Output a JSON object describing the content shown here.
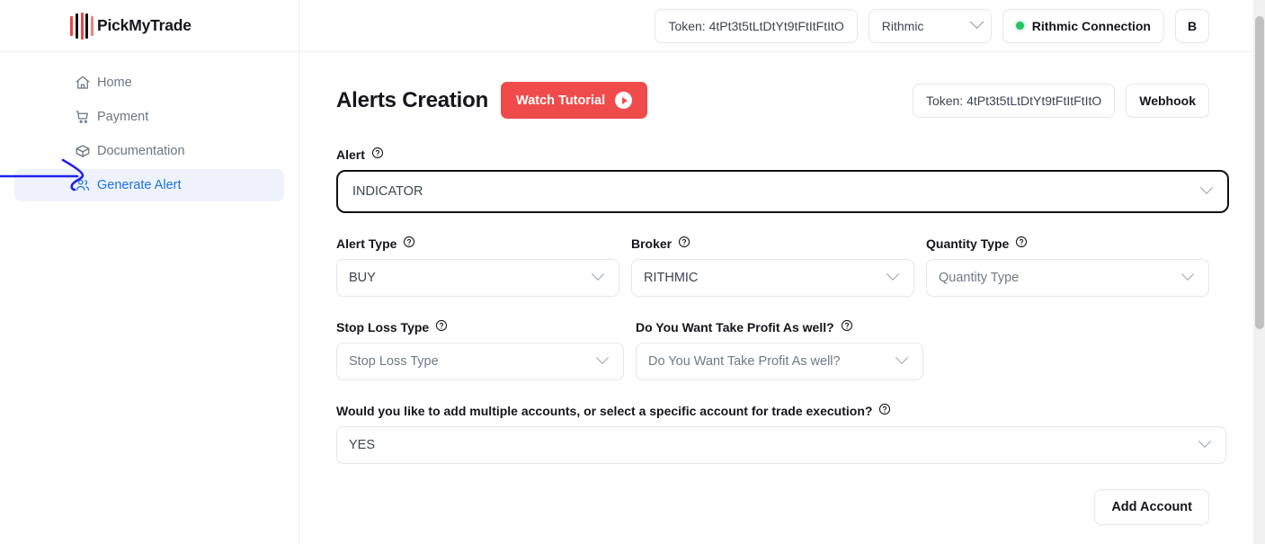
{
  "brand": {
    "name": "PickMyTrade",
    "logo_icon": "pickmytrade-bars-logo"
  },
  "sidebar": {
    "items": [
      {
        "label": "Home",
        "icon": "home-icon",
        "active": false
      },
      {
        "label": "Payment",
        "icon": "cart-icon",
        "active": false
      },
      {
        "label": "Documentation",
        "icon": "box-icon",
        "active": false
      },
      {
        "label": "Generate Alert",
        "icon": "users-icon",
        "active": true
      }
    ],
    "annotation": {
      "type": "hand-drawn-arrow",
      "color": "#2020ee",
      "points_to": "Generate Alert"
    }
  },
  "topbar": {
    "token_pill": "Token: 4tPt3t5tLtDtYt9tFtItFtItO",
    "broker_select": {
      "value": "Rithmic",
      "icon": "chevron-down-icon"
    },
    "connection": {
      "label": "Rithmic Connection",
      "status_color": "#22c55e",
      "icon": "status-dot-icon"
    },
    "user_initial": "B"
  },
  "page": {
    "title": "Alerts Creation",
    "watch_tutorial": {
      "label": "Watch Tutorial",
      "icon": "play-circle-icon",
      "color": "#ef4b4b"
    },
    "token_pill": "Token: 4tPt3t5tLtDtYt9tFtItFtItO",
    "webhook_button": "Webhook"
  },
  "form": {
    "alert": {
      "label": "Alert",
      "help_icon": "question-circle-icon",
      "value": "INDICATOR",
      "is_placeholder": false,
      "focused": true,
      "caret_icon": "chevron-down-icon"
    },
    "alert_type": {
      "label": "Alert Type",
      "help_icon": "question-circle-icon",
      "value": "BUY",
      "is_placeholder": false,
      "caret_icon": "chevron-down-icon"
    },
    "broker": {
      "label": "Broker",
      "help_icon": "question-circle-icon",
      "value": "RITHMIC",
      "is_placeholder": false,
      "caret_icon": "chevron-down-icon"
    },
    "quantity_type": {
      "label": "Quantity Type",
      "help_icon": "question-circle-icon",
      "value": "Quantity Type",
      "is_placeholder": true,
      "caret_icon": "chevron-down-icon"
    },
    "stop_loss_type": {
      "label": "Stop Loss Type",
      "help_icon": "question-circle-icon",
      "value": "Stop Loss Type",
      "is_placeholder": true,
      "caret_icon": "chevron-down-icon"
    },
    "take_profit": {
      "label": "Do You Want Take Profit As well?",
      "help_icon": "question-circle-icon",
      "value": "Do You Want Take Profit As well?",
      "is_placeholder": true,
      "caret_icon": "chevron-down-icon"
    },
    "multiple_accounts": {
      "label": "Would you like to add multiple accounts, or select a specific account for trade execution?",
      "help_icon": "question-circle-icon",
      "value": "YES",
      "is_placeholder": false,
      "caret_icon": "chevron-down-icon"
    },
    "add_account_button": "Add Account"
  }
}
